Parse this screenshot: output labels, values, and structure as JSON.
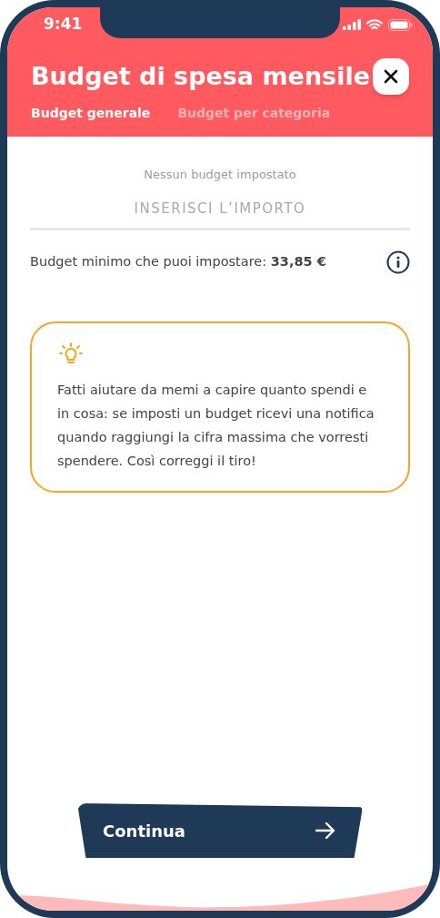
{
  "status_bar": {
    "time": "9:41"
  },
  "header": {
    "title": "Budget di spesa mensile"
  },
  "tabs": [
    {
      "label": "Budget generale",
      "selected": true
    },
    {
      "label": "Budget per categoria",
      "selected": false
    }
  ],
  "budget_status": "Nessun budget impostato",
  "amount_field": {
    "placeholder": "INSERISCI L’IMPORTO"
  },
  "minimum_budget": "Budget minimo che puoi impostare: **33,85 €**",
  "tip": {
    "text": "Fatti aiutare da memi a capire quanto spendi e in cosa: se imposti un budget ricevi una notifica quando raggiungi la cifra massima che vorresti spendere. Così correggi il tiro!"
  },
  "continue_button": {
    "label": "Continua"
  }
}
